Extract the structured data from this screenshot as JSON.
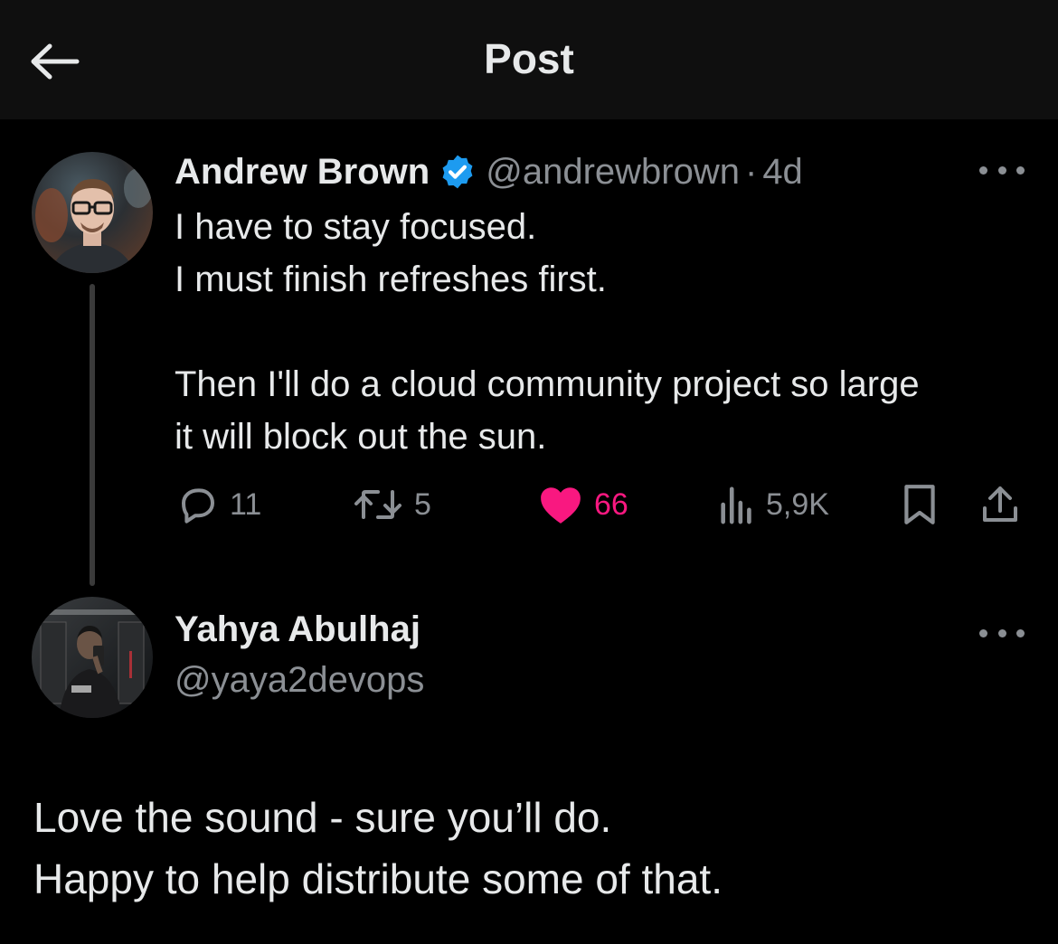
{
  "header": {
    "title": "Post",
    "back_icon": "arrow-left-icon"
  },
  "original_post": {
    "author_name": "Andrew Brown",
    "verified_icon": "verified-badge-icon",
    "handle": "@andrewbrown",
    "separator": "·",
    "time": "4d",
    "more_icon": "more-horizontal-icon",
    "lines": [
      "I have to stay focused.",
      "I must finish refreshes first.",
      "Then I'll do a cloud community project so large",
      "it will block out the sun."
    ],
    "actions": {
      "replies": "11",
      "reposts": "5",
      "likes": "66",
      "views": "5,9K"
    },
    "colors": {
      "verified": "#1d9bf0",
      "like": "#f91880"
    }
  },
  "reply": {
    "author_name": "Yahya Abulhaj",
    "handle": "@yaya2devops",
    "more_icon": "more-horizontal-icon",
    "lines": [
      "Love the sound - sure you’ll do.",
      "Happy to help distribute some of that."
    ]
  }
}
